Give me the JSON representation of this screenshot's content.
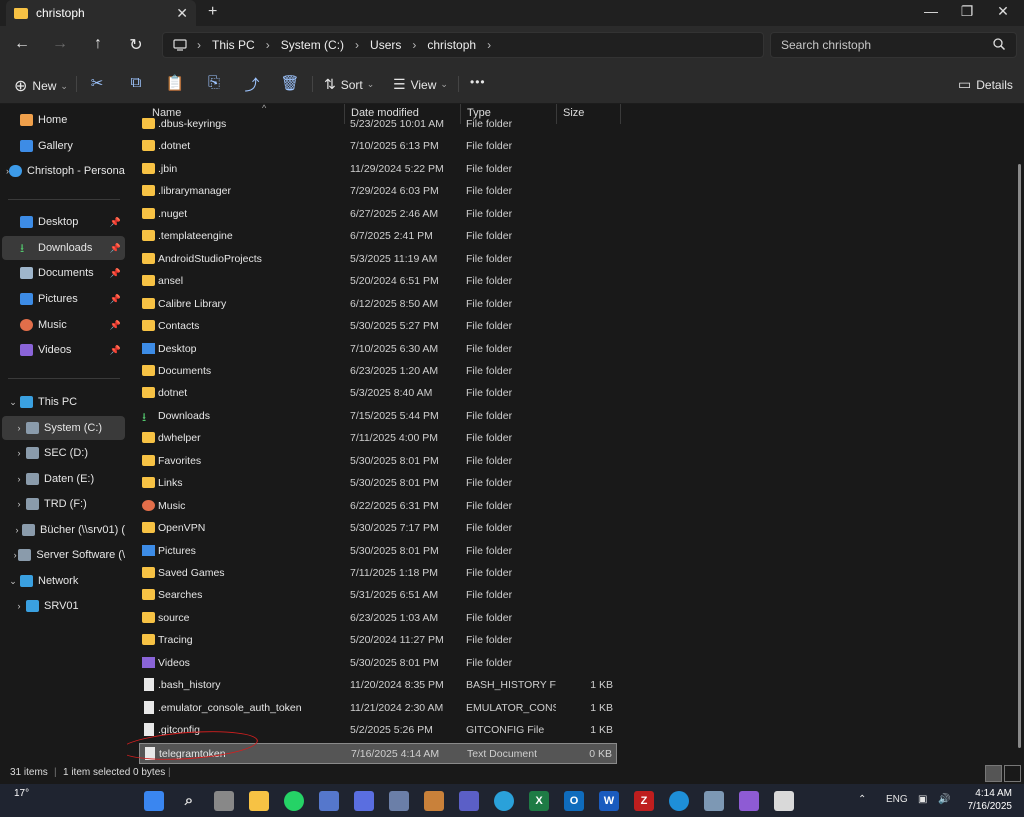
{
  "window": {
    "tab_title": "christoph",
    "new_tab": "+",
    "close_tab": "✕",
    "minimize": "—",
    "maximize": "❐",
    "close": "✕"
  },
  "nav": {
    "breadcrumb": [
      "This PC",
      "System (C:)",
      "Users",
      "christoph"
    ],
    "search_placeholder": "Search christoph"
  },
  "toolbar": {
    "new_label": "New",
    "sort_label": "Sort",
    "view_label": "View",
    "more_label": "•••",
    "details_label": "Details"
  },
  "sidebar": {
    "quick": [
      {
        "label": "Home",
        "icon": "home-icon"
      },
      {
        "label": "Gallery",
        "icon": "gallery-icon"
      },
      {
        "label": "Christoph - Personal",
        "icon": "cloud-icon"
      }
    ],
    "pinned": [
      {
        "label": "Desktop",
        "icon": "desktop-icon"
      },
      {
        "label": "Downloads",
        "icon": "downloads-icon"
      },
      {
        "label": "Documents",
        "icon": "documents-icon"
      },
      {
        "label": "Pictures",
        "icon": "pictures-icon"
      },
      {
        "label": "Music",
        "icon": "music-icon"
      },
      {
        "label": "Videos",
        "icon": "videos-icon"
      }
    ],
    "tree": [
      {
        "label": "This PC",
        "icon": "pc-icon"
      },
      {
        "label": "System (C:)",
        "icon": "drive-icon"
      },
      {
        "label": "SEC (D:)",
        "icon": "drive-icon"
      },
      {
        "label": "Daten (E:)",
        "icon": "drive-icon"
      },
      {
        "label": "TRD (F:)",
        "icon": "drive-icon"
      },
      {
        "label": "Bücher (\\\\srv01) (",
        "icon": "network-drive-icon"
      },
      {
        "label": "Server Software (\\",
        "icon": "network-drive-icon"
      },
      {
        "label": "Network",
        "icon": "network-icon"
      },
      {
        "label": "SRV01",
        "icon": "computer-icon"
      }
    ]
  },
  "columns": {
    "name": "Name",
    "date": "Date modified",
    "type": "Type",
    "size": "Size"
  },
  "files": [
    {
      "name": ".dbus-keyrings",
      "date": "5/23/2025 10:01 AM",
      "type": "File folder",
      "size": "",
      "icon": "folder"
    },
    {
      "name": ".dotnet",
      "date": "7/10/2025 6:13 PM",
      "type": "File folder",
      "size": "",
      "icon": "folder"
    },
    {
      "name": ".jbin",
      "date": "11/29/2024 5:22 PM",
      "type": "File folder",
      "size": "",
      "icon": "folder"
    },
    {
      "name": ".librarymanager",
      "date": "7/29/2024 6:03 PM",
      "type": "File folder",
      "size": "",
      "icon": "folder"
    },
    {
      "name": ".nuget",
      "date": "6/27/2025 2:46 AM",
      "type": "File folder",
      "size": "",
      "icon": "folder"
    },
    {
      "name": ".templateengine",
      "date": "6/7/2025 2:41 PM",
      "type": "File folder",
      "size": "",
      "icon": "folder"
    },
    {
      "name": "AndroidStudioProjects",
      "date": "5/3/2025 11:19 AM",
      "type": "File folder",
      "size": "",
      "icon": "folder"
    },
    {
      "name": "ansel",
      "date": "5/20/2024 6:51 PM",
      "type": "File folder",
      "size": "",
      "icon": "folder"
    },
    {
      "name": "Calibre Library",
      "date": "6/12/2025 8:50 AM",
      "type": "File folder",
      "size": "",
      "icon": "folder"
    },
    {
      "name": "Contacts",
      "date": "5/30/2025 5:27 PM",
      "type": "File folder",
      "size": "",
      "icon": "folder"
    },
    {
      "name": "Desktop",
      "date": "7/10/2025 6:30 AM",
      "type": "File folder",
      "size": "",
      "icon": "desktop"
    },
    {
      "name": "Documents",
      "date": "6/23/2025 1:20 AM",
      "type": "File folder",
      "size": "",
      "icon": "documents"
    },
    {
      "name": "dotnet",
      "date": "5/3/2025 8:40 AM",
      "type": "File folder",
      "size": "",
      "icon": "folder"
    },
    {
      "name": "Downloads",
      "date": "7/15/2025 5:44 PM",
      "type": "File folder",
      "size": "",
      "icon": "downloads"
    },
    {
      "name": "dwhelper",
      "date": "7/11/2025 4:00 PM",
      "type": "File folder",
      "size": "",
      "icon": "folder"
    },
    {
      "name": "Favorites",
      "date": "5/30/2025 8:01 PM",
      "type": "File folder",
      "size": "",
      "icon": "folder"
    },
    {
      "name": "Links",
      "date": "5/30/2025 8:01 PM",
      "type": "File folder",
      "size": "",
      "icon": "folder"
    },
    {
      "name": "Music",
      "date": "6/22/2025 6:31 PM",
      "type": "File folder",
      "size": "",
      "icon": "music"
    },
    {
      "name": "OpenVPN",
      "date": "5/30/2025 7:17 PM",
      "type": "File folder",
      "size": "",
      "icon": "folder"
    },
    {
      "name": "Pictures",
      "date": "5/30/2025 8:01 PM",
      "type": "File folder",
      "size": "",
      "icon": "pictures"
    },
    {
      "name": "Saved Games",
      "date": "7/11/2025 1:18 PM",
      "type": "File folder",
      "size": "",
      "icon": "folder"
    },
    {
      "name": "Searches",
      "date": "5/31/2025 6:51 AM",
      "type": "File folder",
      "size": "",
      "icon": "folder"
    },
    {
      "name": "source",
      "date": "6/23/2025 1:03 AM",
      "type": "File folder",
      "size": "",
      "icon": "folder"
    },
    {
      "name": "Tracing",
      "date": "5/20/2024 11:27 PM",
      "type": "File folder",
      "size": "",
      "icon": "folder"
    },
    {
      "name": "Videos",
      "date": "5/30/2025 8:01 PM",
      "type": "File folder",
      "size": "",
      "icon": "videos"
    },
    {
      "name": ".bash_history",
      "date": "11/20/2024 8:35 PM",
      "type": "BASH_HISTORY File",
      "size": "1 KB",
      "icon": "doc"
    },
    {
      "name": ".emulator_console_auth_token",
      "date": "11/21/2024 2:30 AM",
      "type": "EMULATOR_CONS...",
      "size": "1 KB",
      "icon": "doc"
    },
    {
      "name": ".gitconfig",
      "date": "5/2/2025 5:26 PM",
      "type": "GITCONFIG File",
      "size": "1 KB",
      "icon": "doc"
    },
    {
      "name": "telegramtoken",
      "date": "7/16/2025 4:14 AM",
      "type": "Text Document",
      "size": "0 KB",
      "icon": "doc",
      "selected": true
    }
  ],
  "status": {
    "count": "31 items",
    "selection": "1 item selected  0 bytes"
  },
  "taskbar": {
    "weather": "17°",
    "lang": "ENG",
    "time": "4:14 AM",
    "date": "7/16/2025"
  },
  "colors": {
    "folder": "#f7c244",
    "accent": "#9ec5ff",
    "annotation_circle": "#d21f1f"
  }
}
